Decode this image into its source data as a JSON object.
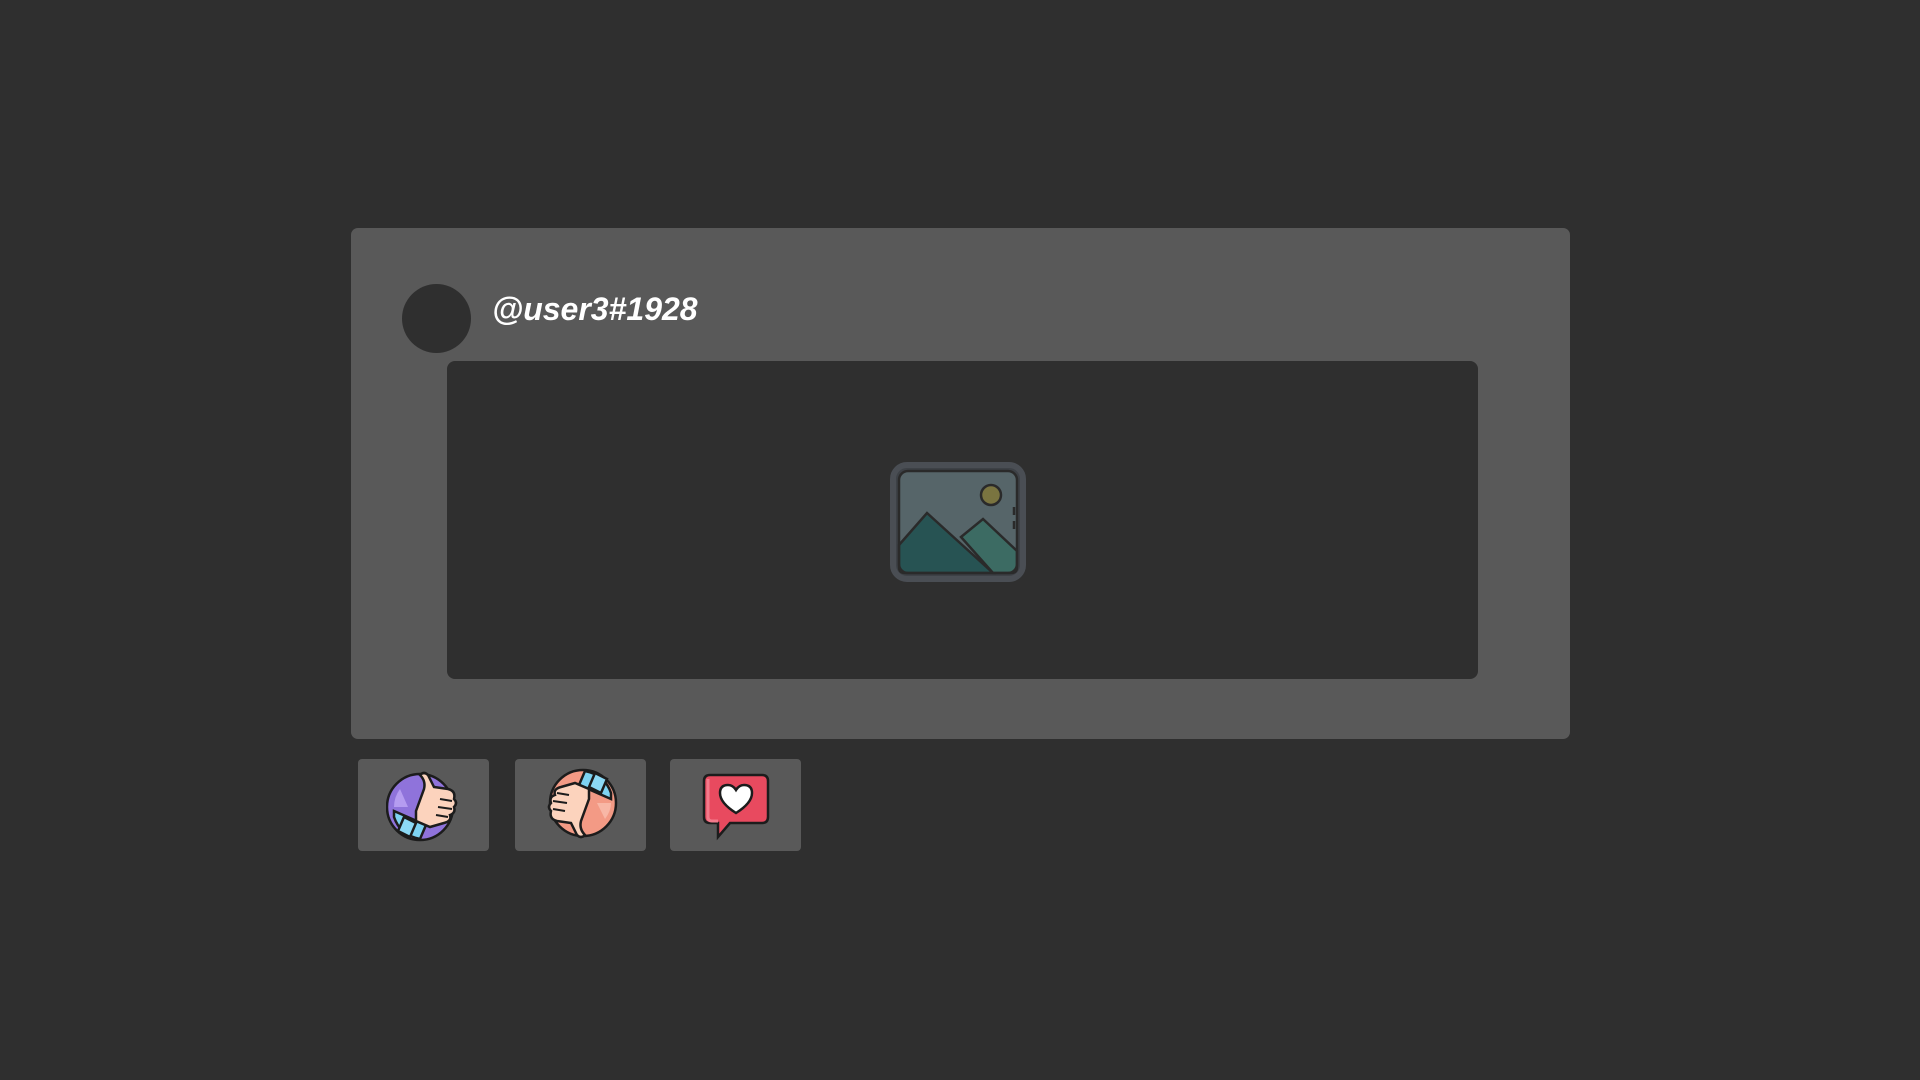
{
  "post": {
    "username": "@user3#1928",
    "media_icon": "image-placeholder-icon"
  },
  "reactions": [
    {
      "name": "like",
      "icon": "thumbs-up-icon"
    },
    {
      "name": "dislike",
      "icon": "thumbs-down-icon"
    },
    {
      "name": "love",
      "icon": "heart-speech-bubble-icon"
    }
  ],
  "colors": {
    "background": "#2f2f2f",
    "card": "#595959",
    "username_text": "#ffffff",
    "like_accent": "#8b6fd8",
    "dislike_accent": "#f4907c",
    "love_accent": "#e84a5f"
  }
}
